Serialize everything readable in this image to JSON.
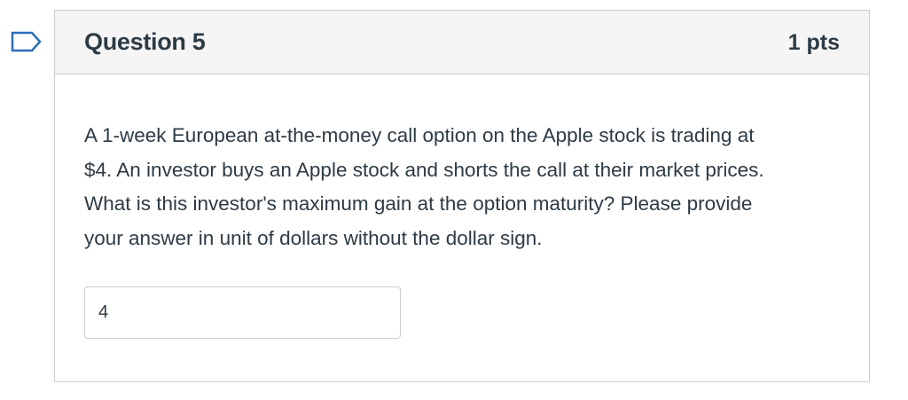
{
  "question": {
    "title": "Question 5",
    "points": "1 pts",
    "lines": [
      "A 1-week European at-the-money call option on the Apple stock is trading at",
      "$4. An investor buys an Apple stock and shorts the call at their market prices.",
      "What is this investor's maximum gain at the option maturity? Please provide",
      "your answer in unit of dollars without the dollar sign."
    ],
    "answer_value": "4"
  },
  "colors": {
    "flag_outline": "#2d6fb6",
    "border": "#c7cdd1",
    "header_bg": "#f5f5f5",
    "text": "#2d3b45"
  },
  "icons": {
    "flag": "bookmark-flag-icon"
  }
}
